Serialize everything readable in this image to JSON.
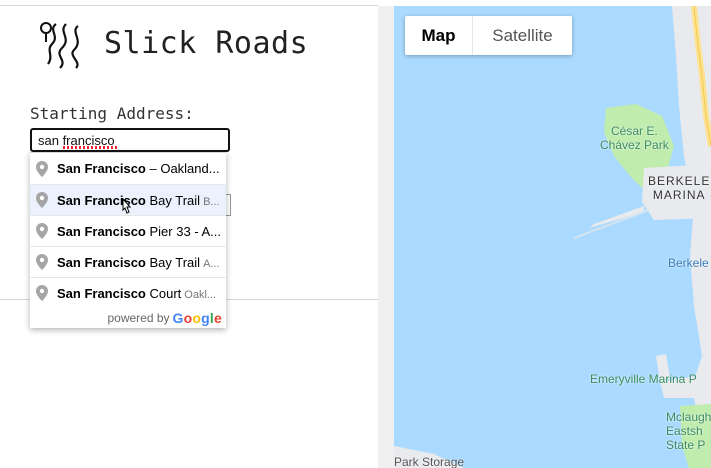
{
  "app": {
    "title": "Slick Roads",
    "logo_icon": "winding-road-icon"
  },
  "form": {
    "starting_address_label": "Starting Address:",
    "starting_address_value": "san francisco"
  },
  "autocomplete": {
    "suggestions": [
      {
        "match": "San Francisco",
        "rest": " – Oakland...",
        "secondary": ""
      },
      {
        "match": "San Francisco",
        "rest": " Bay Trail",
        "secondary": "B..."
      },
      {
        "match": "San Francisco",
        "rest": " Pier 33 - A...",
        "secondary": ""
      },
      {
        "match": "San Francisco",
        "rest": " Bay Trail",
        "secondary": "A..."
      },
      {
        "match": "San Francisco",
        "rest": " Court",
        "secondary": "Oakl..."
      }
    ],
    "powered_by": "powered by",
    "google": [
      "G",
      "o",
      "o",
      "g",
      "l",
      "e"
    ],
    "google_colors": [
      "#4285F4",
      "#EA4335",
      "#FBBC05",
      "#4285F4",
      "#34A853",
      "#EA4335"
    ],
    "pin_icon": "map-pin-icon"
  },
  "map": {
    "type_buttons": {
      "map": "Map",
      "satellite": "Satellite"
    },
    "selected_type": "Map",
    "labels": {
      "park_line1": "César E.",
      "park_line2": "Chávez Park",
      "marina_line1": "BERKELE",
      "marina_line2": "MARINA",
      "berkeley": "Berkele",
      "emeryville": "Emeryville Marina P",
      "mclaughlin_line1": "Mclaugh",
      "mclaughlin_line2": "Eastsh",
      "mclaughlin_line3": "State P",
      "park_storage": "Park Storage"
    },
    "colors": {
      "water": "#aadaff",
      "land": "#e8eaed",
      "park": "#c0ecae",
      "highway": "#fde293"
    }
  }
}
